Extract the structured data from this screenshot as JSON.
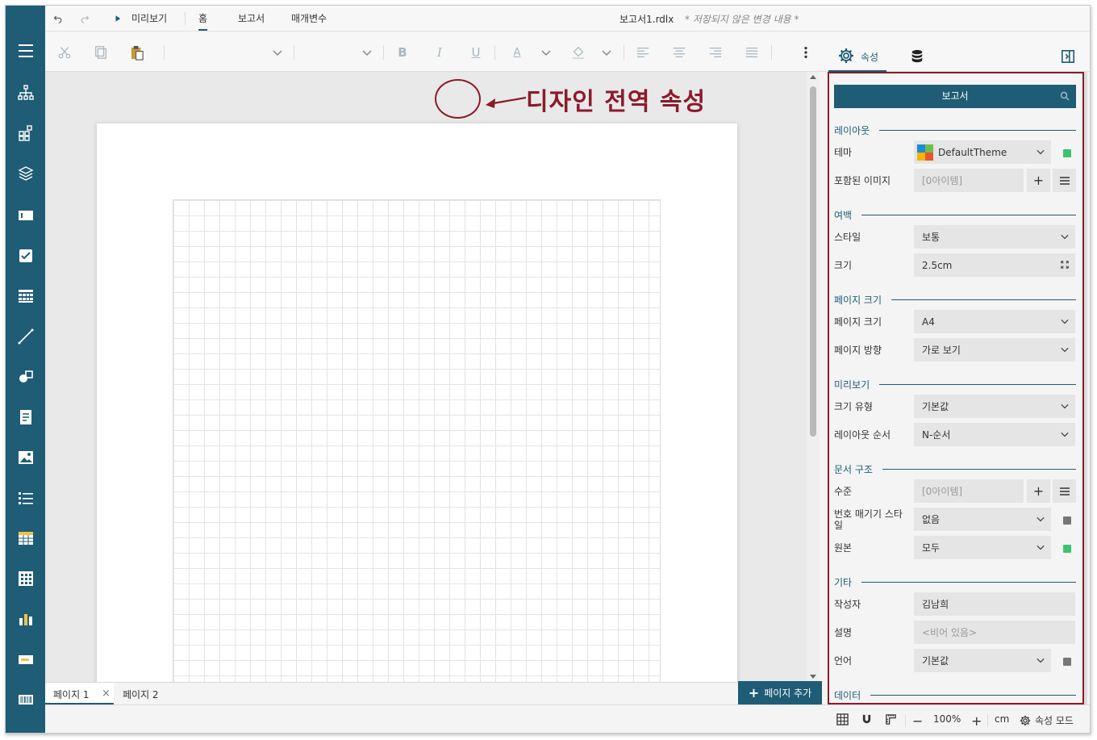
{
  "header": {
    "preview_label": "미리보기",
    "menu_tabs": [
      "홈",
      "보고서",
      "매개변수"
    ],
    "doc_title": "보고서1.rdlx",
    "doc_status": "* 저장되지 않은 변경 내용 *"
  },
  "toolbar": {
    "bold": "B",
    "italic": "I",
    "underline": "U",
    "font_color_glyph": "A",
    "properties_tab": "속성"
  },
  "annotation": {
    "text": "디자인 전역 속성",
    "color": "#8b1a2b"
  },
  "page_tabs": {
    "tabs": [
      "페이지 1",
      "페이지 2"
    ],
    "close_glyph": "×",
    "add_label": "페이지 추가"
  },
  "status_bar": {
    "zoom": "100%",
    "unit": "cm",
    "mode_label": "속성 모드"
  },
  "panel": {
    "title": "보고서",
    "sections": {
      "layout": "레이아웃",
      "margin": "여백",
      "page_size": "페이지 크기",
      "preview": "미리보기",
      "doc_structure": "문서 구조",
      "misc": "기타",
      "data": "데이터"
    },
    "props": {
      "theme": {
        "label": "테마",
        "value": "DefaultTheme"
      },
      "embedded_images": {
        "label": "포함된 이미지",
        "value": "[0아이템]"
      },
      "margin_style": {
        "label": "스타일",
        "value": "보통"
      },
      "margin_size": {
        "label": "크기",
        "value": "2.5cm"
      },
      "page_size": {
        "label": "페이지 크기",
        "value": "A4"
      },
      "page_orientation": {
        "label": "페이지 방향",
        "value": "가로 보기"
      },
      "size_type": {
        "label": "크기 유형",
        "value": "기본값"
      },
      "layout_order": {
        "label": "레이아웃 순서",
        "value": "N-순서"
      },
      "level": {
        "label": "수준",
        "value": "[0아이템]"
      },
      "numbering_style": {
        "label": "번호 매기기 스타일",
        "value": "없음"
      },
      "source": {
        "label": "원본",
        "value": "모두"
      },
      "author": {
        "label": "작성자",
        "value": "김남희"
      },
      "description": {
        "label": "설명",
        "value": "<비어 있음>"
      },
      "language": {
        "label": "언어",
        "value": "기본값"
      }
    }
  },
  "colors": {
    "accent": "#1f5c75",
    "highlight_border": "#8b1a2b",
    "indicator_green": "#3cc36e",
    "indicator_gray": "#777777"
  }
}
